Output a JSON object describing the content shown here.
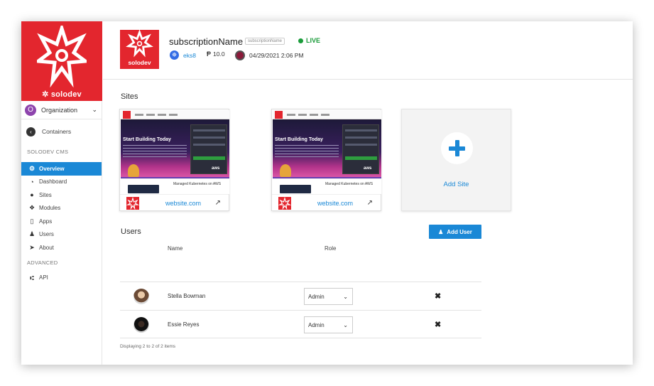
{
  "brand": {
    "name": "solodev",
    "logo_color": "#e3262e"
  },
  "org": {
    "initial": "O",
    "label": "Organization",
    "avatar_color": "#8e44ad"
  },
  "sidebar": {
    "containers_label": "Containers",
    "cms_section": "SOLODEV CMS",
    "advanced_section": "ADVANCED",
    "items": [
      {
        "label": "Overview",
        "icon": "cogs-icon",
        "active": true
      },
      {
        "label": "Dashboard",
        "icon": "dashboard-icon"
      },
      {
        "label": "Sites",
        "icon": "globe-icon"
      },
      {
        "label": "Modules",
        "icon": "cubes-icon"
      },
      {
        "label": "Apps",
        "icon": "mobile-icon"
      },
      {
        "label": "Users",
        "icon": "user-icon"
      },
      {
        "label": "About",
        "icon": "location-arrow-icon"
      }
    ],
    "api_label": "API"
  },
  "header": {
    "logo_text": "solodev",
    "subscription_name": "subscriptionName",
    "subscription_chip": "subscriptionName",
    "status": "LIVE",
    "status_color": "#1a9b3a",
    "cluster": "eks8",
    "version": "10.0",
    "timestamp": "04/29/2021 2:06 PM"
  },
  "sites": {
    "heading": "Sites",
    "cards": [
      {
        "thumb_title": "Start Building Today",
        "mid_text": "Managed Kubernetes on AWS",
        "url": "website.com"
      },
      {
        "thumb_title": "Start Building Today",
        "mid_text": "Managed Kubernetes on AWS",
        "url": "website.com"
      }
    ],
    "add_label": "Add Site"
  },
  "users": {
    "heading": "Users",
    "add_button": "Add User",
    "columns": {
      "name": "Name",
      "role": "Role"
    },
    "rows": [
      {
        "name": "Stella Bowman",
        "role": "Admin"
      },
      {
        "name": "Essie Reyes",
        "role": "Admin"
      }
    ],
    "footer": "Displaying 2 to 2 of 2 items"
  },
  "colors": {
    "accent": "#1a88d6",
    "brand": "#e3262e"
  }
}
